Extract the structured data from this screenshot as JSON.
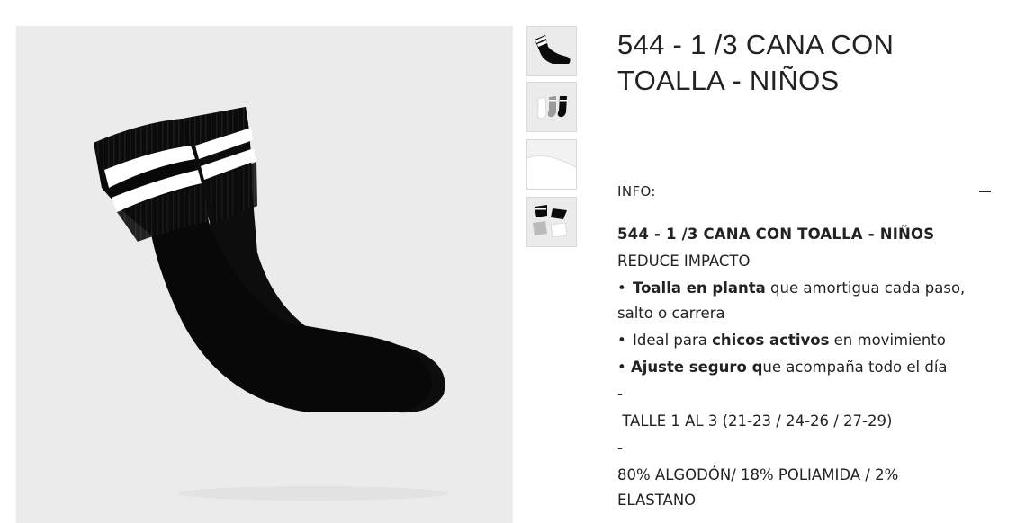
{
  "product": {
    "title": "544 - 1 /3 CANA CON TOALLA - NIÑOS",
    "main_image_alt": "Pair of black ribbed socks with two white stripes",
    "thumbnails": [
      {
        "alt": "Black ankle sock"
      },
      {
        "alt": "Socks in white, grey and black"
      },
      {
        "alt": "White fabric detail"
      },
      {
        "alt": "Multiple socks set"
      }
    ]
  },
  "info": {
    "label": "INFO:",
    "toggle_icon": "minus-icon"
  },
  "description": {
    "heading": "544 - 1 /3 CANA CON TOALLA - NIÑOS",
    "subheading": "REDUCE IMPACTO",
    "bullet1_bold": "Toalla en planta",
    "bullet1_rest": " que amortigua cada paso,",
    "bullet1_cont": "salto o carrera",
    "bullet2_pre": "Ideal para ",
    "bullet2_bold": "chicos activos",
    "bullet2_rest": " en movimiento",
    "bullet3_bold": "Ajuste seguro q",
    "bullet3_rest": "ue acompaña todo el día",
    "separator1": "-",
    "sizes": " TALLE 1 AL 3 (21-23 / 24-26 / 27-29)",
    "separator2": "-",
    "composition_line1": "80% ALGODÓN/ 18% POLIAMIDA / 2%",
    "composition_line2": "ELASTANO"
  },
  "colors": {
    "background": "#ffffff",
    "image_background": "#ebebeb",
    "sock": "#0b0b0b",
    "stripe": "#ffffff",
    "text": "#222222"
  }
}
